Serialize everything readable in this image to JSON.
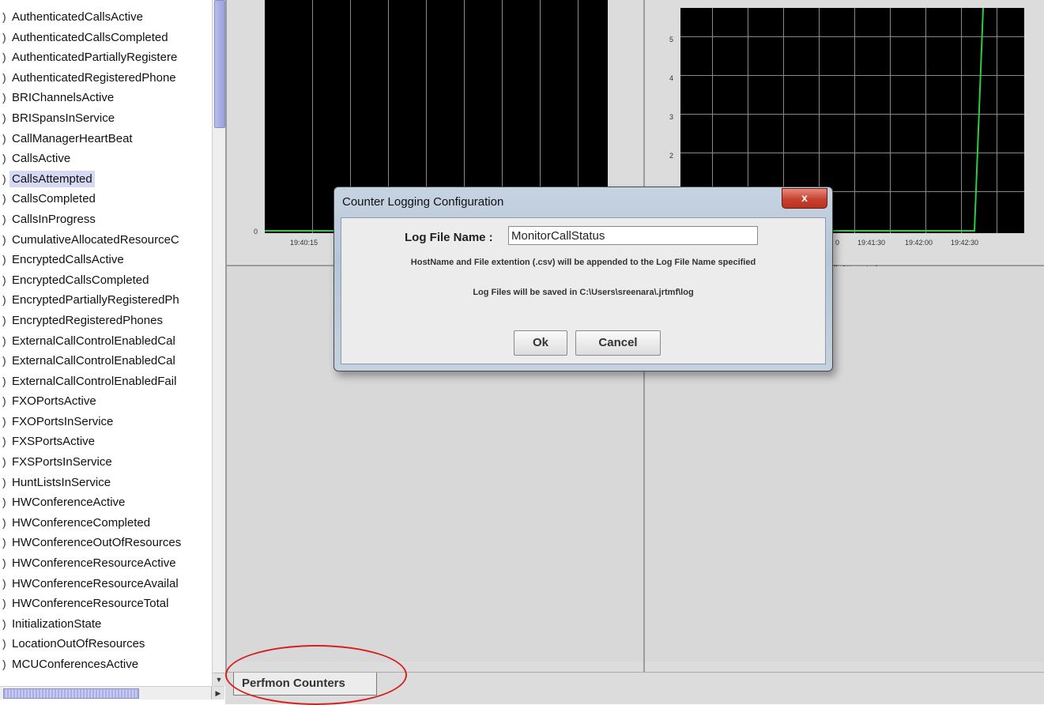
{
  "counter_list": {
    "items": [
      {
        "label": "AuthenticatedCallsActive"
      },
      {
        "label": "AuthenticatedCallsCompleted"
      },
      {
        "label": "AuthenticatedPartiallyRegistere"
      },
      {
        "label": "AuthenticatedRegisteredPhone"
      },
      {
        "label": "BRIChannelsActive"
      },
      {
        "label": "BRISpansInService"
      },
      {
        "label": "CallManagerHeartBeat"
      },
      {
        "label": "CallsActive"
      },
      {
        "label": "CallsAttempted",
        "selected": true
      },
      {
        "label": "CallsCompleted"
      },
      {
        "label": "CallsInProgress"
      },
      {
        "label": "CumulativeAllocatedResourceC"
      },
      {
        "label": "EncryptedCallsActive"
      },
      {
        "label": "EncryptedCallsCompleted"
      },
      {
        "label": "EncryptedPartiallyRegisteredPh"
      },
      {
        "label": "EncryptedRegisteredPhones"
      },
      {
        "label": "ExternalCallControlEnabledCal"
      },
      {
        "label": "ExternalCallControlEnabledCal"
      },
      {
        "label": "ExternalCallControlEnabledFail"
      },
      {
        "label": "FXOPortsActive"
      },
      {
        "label": "FXOPortsInService"
      },
      {
        "label": "FXSPortsActive"
      },
      {
        "label": "FXSPortsInService"
      },
      {
        "label": "HuntListsInService"
      },
      {
        "label": "HWConferenceActive"
      },
      {
        "label": "HWConferenceCompleted"
      },
      {
        "label": "HWConferenceOutOfResources"
      },
      {
        "label": "HWConferenceResourceActive"
      },
      {
        "label": "HWConferenceResourceAvailal"
      },
      {
        "label": "HWConferenceResourceTotal"
      },
      {
        "label": "InitializationState"
      },
      {
        "label": "LocationOutOfResources"
      },
      {
        "label": "MCUConferencesActive"
      }
    ]
  },
  "chart_left": {
    "y_tick": "0",
    "x_tick": "19:40:15"
  },
  "chart_right": {
    "y_ticks": [
      "5",
      "4",
      "3",
      "2"
    ],
    "x_ticks": [
      "19:41:30",
      "19:42:00",
      "19:42:30"
    ],
    "x_tick_partial": "0",
    "legend_partial": "llsAttempted",
    "line_color": "#2ecc40"
  },
  "dialog": {
    "title": "Counter Logging Configuration",
    "close_glyph": "x",
    "log_file_label": "Log File Name :",
    "log_file_value": "MonitorCallStatus",
    "note_append": "HostName and File extention (.csv) will be appended to the Log File Name specified",
    "note_saved": "Log Files will be saved in C:\\Users\\sreenara\\.jrtmf\\log",
    "ok_label": "Ok",
    "cancel_label": "Cancel"
  },
  "tabs": {
    "perfmon_label": "Perfmon Counters"
  },
  "colors": {
    "annotation": "#d62020",
    "selection": "#d5d9f3",
    "chart_bg": "#000000"
  }
}
